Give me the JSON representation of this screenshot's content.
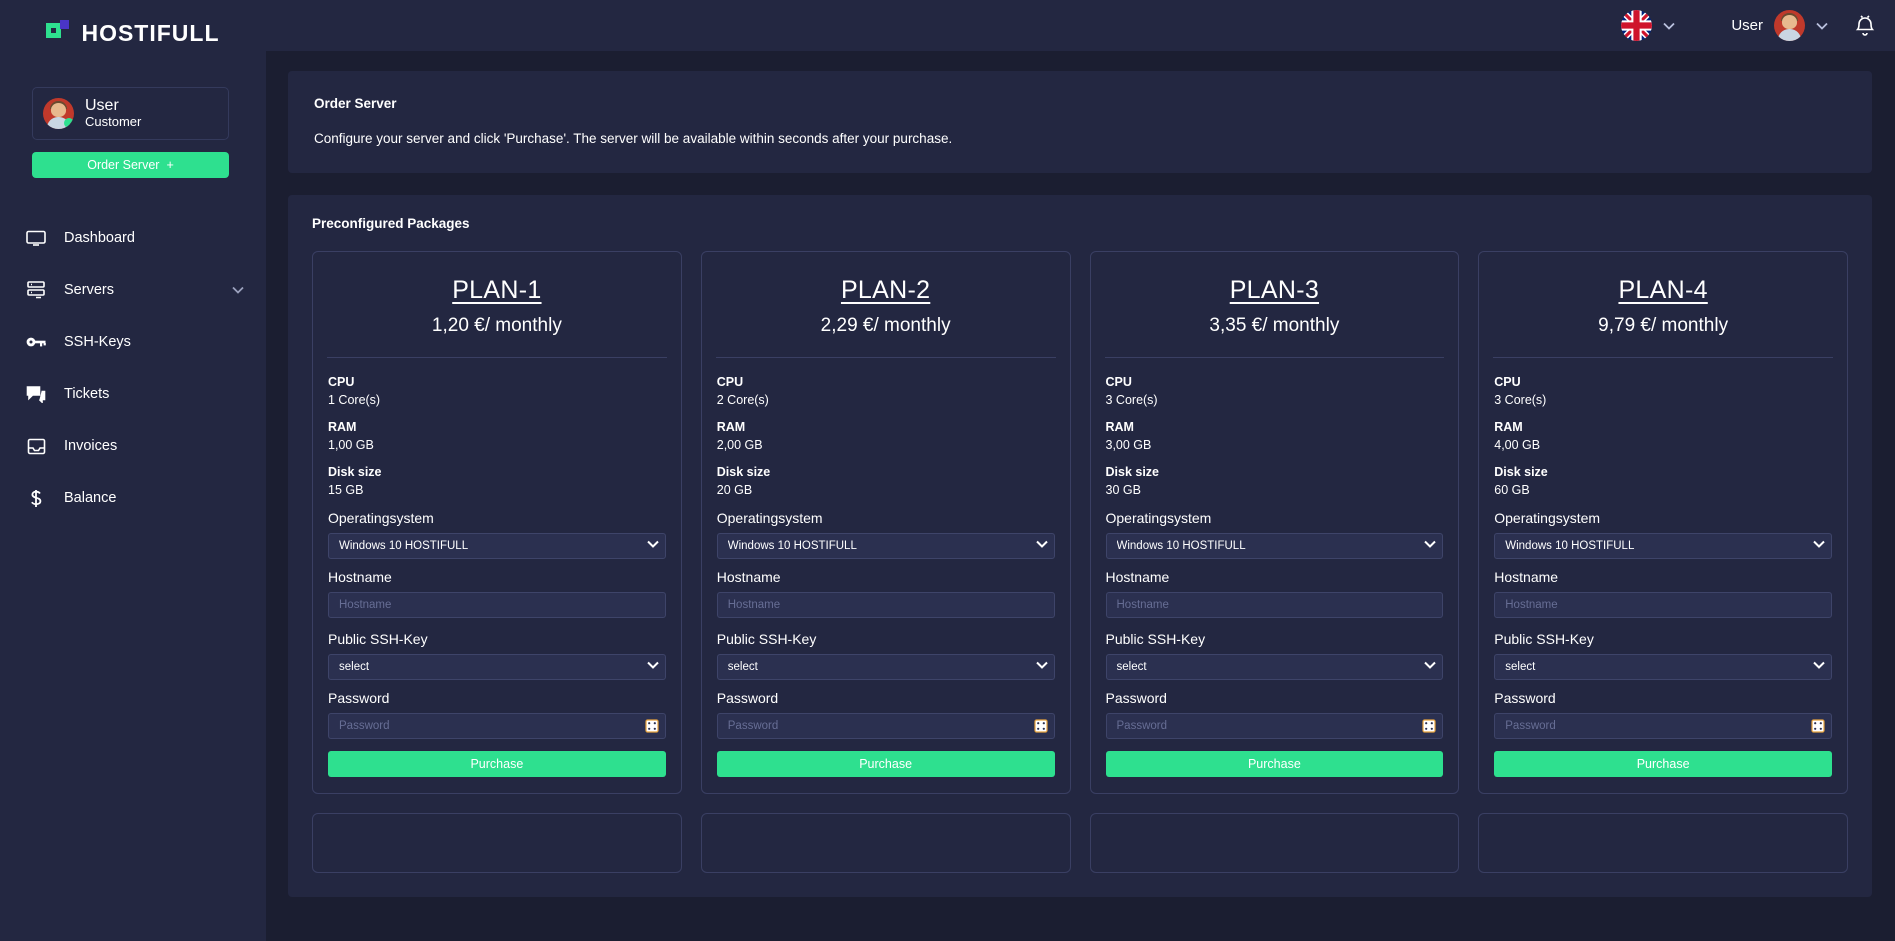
{
  "brand": {
    "name": "HOSTIFULL"
  },
  "sidebar": {
    "user": {
      "name": "User",
      "role": "Customer"
    },
    "order_button": {
      "label": "Order Server",
      "plus": "+"
    },
    "items": [
      {
        "label": "Dashboard",
        "icon": "monitor-icon",
        "has_chevron": false
      },
      {
        "label": "Servers",
        "icon": "server-icon",
        "has_chevron": true
      },
      {
        "label": "SSH-Keys",
        "icon": "key-icon",
        "has_chevron": false
      },
      {
        "label": "Tickets",
        "icon": "ticket-chat-icon",
        "has_chevron": false
      },
      {
        "label": "Invoices",
        "icon": "invoice-icon",
        "has_chevron": false
      },
      {
        "label": "Balance",
        "icon": "dollar-icon",
        "has_chevron": false
      }
    ]
  },
  "topbar": {
    "language": {
      "icon": "uk-flag-icon",
      "chevron": "chevron-down-icon"
    },
    "user": {
      "name": "User",
      "avatar": "avatar-icon",
      "chevron": "chevron-down-icon"
    },
    "notifications": {
      "icon": "bell-icon"
    }
  },
  "order_panel": {
    "title": "Order Server",
    "description": "Configure your server and click 'Purchase'. The server will be available within seconds after your purchase."
  },
  "packages": {
    "title": "Preconfigured Packages",
    "labels": {
      "cpu": "CPU",
      "ram": "RAM",
      "disk": "Disk size",
      "os": "Operatingsystem",
      "hostname": "Hostname",
      "sshkey": "Public SSH-Key",
      "password": "Password",
      "purchase": "Purchase"
    },
    "placeholders": {
      "hostname": "Hostname",
      "password": "Password"
    },
    "defaults": {
      "os": "Windows 10 HOSTIFULL",
      "sshkey": "select"
    },
    "cards": [
      {
        "name": "PLAN-1",
        "price": "1,20 €/ monthly",
        "cpu": "1 Core(s)",
        "ram": "1,00 GB",
        "disk": "15 GB"
      },
      {
        "name": "PLAN-2",
        "price": "2,29 €/ monthly",
        "cpu": "2 Core(s)",
        "ram": "2,00 GB",
        "disk": "20 GB"
      },
      {
        "name": "PLAN-3",
        "price": "3,35 €/ monthly",
        "cpu": "3 Core(s)",
        "ram": "3,00 GB",
        "disk": "30 GB"
      },
      {
        "name": "PLAN-4",
        "price": "9,79 €/ monthly",
        "cpu": "3 Core(s)",
        "ram": "4,00 GB",
        "disk": "60 GB"
      }
    ]
  },
  "colors": {
    "accent_green": "#2ee08f",
    "sidebar_bg": "#232741",
    "page_bg": "#1b1e31",
    "field_bg": "#2b3050",
    "border": "#3a3f63"
  }
}
